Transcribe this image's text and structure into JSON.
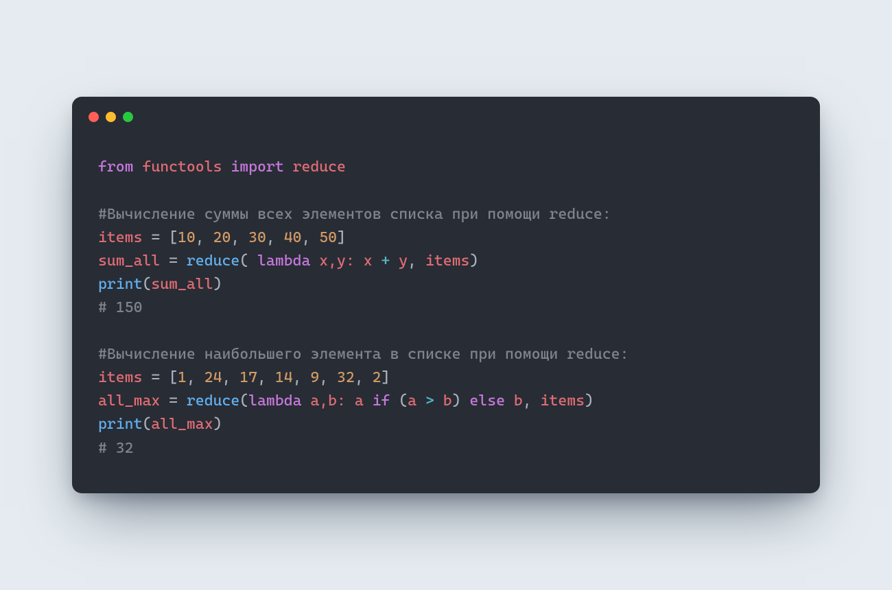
{
  "colors": {
    "page_bg": "#e5ebf0",
    "window_bg": "#282c34",
    "dot_red": "#ff5f56",
    "dot_yellow": "#ffbd2e",
    "dot_green": "#27c93f",
    "base": "#abb2bf",
    "keyword": "#c678dd",
    "identifier": "#e06c75",
    "function": "#61afef",
    "number": "#d19a66",
    "operator": "#56b6c2",
    "comment": "#7f848e"
  },
  "code": {
    "l1": {
      "from": "from",
      "mod": "functools",
      "import": "import",
      "name": "reduce"
    },
    "l3": {
      "comment": "#Вычисление суммы всех элементов списка при помощи reduce:"
    },
    "l4": {
      "lhs": "items",
      "eq": " = ",
      "lb": "[",
      "n0": "10",
      "c": ", ",
      "n1": "20",
      "n2": "30",
      "n3": "40",
      "n4": "50",
      "rb": "]"
    },
    "l5": {
      "lhs": "sum_all",
      "eq": " = ",
      "fn": "reduce",
      "lp": "( ",
      "lam": "lambda",
      "params": " x,y: ",
      "a": "x",
      "op": " + ",
      "b": "y",
      "comma": ", ",
      "arg": "items",
      "rp": ")"
    },
    "l6": {
      "fn": "print",
      "lp": "(",
      "arg": "sum_all",
      "rp": ")"
    },
    "l7": {
      "comment": "# 150"
    },
    "l9": {
      "comment": "#Вычисление наибольшего элемента в списке при помощи reduce:"
    },
    "l10": {
      "lhs": "items",
      "eq": " = ",
      "lb": "[",
      "n0": "1",
      "c": ", ",
      "n1": "24",
      "n2": "17",
      "n3": "14",
      "n4": "9",
      "n5": "32",
      "n6": "2",
      "rb": "]"
    },
    "l11": {
      "lhs": "all_max",
      "eq": " = ",
      "fn": "reduce",
      "lp": "(",
      "lam": "lambda",
      "params": " a,b: ",
      "a": "a",
      "if": " if ",
      "pl": "(",
      "cmpA": "a",
      "gt": " > ",
      "cmpB": "b",
      "pr": ")",
      "else": " else ",
      "b": "b",
      "comma": ", ",
      "arg": "items",
      "rp": ")"
    },
    "l12": {
      "fn": "print",
      "lp": "(",
      "arg": "all_max",
      "rp": ")"
    },
    "l13": {
      "comment": "# 32"
    }
  }
}
